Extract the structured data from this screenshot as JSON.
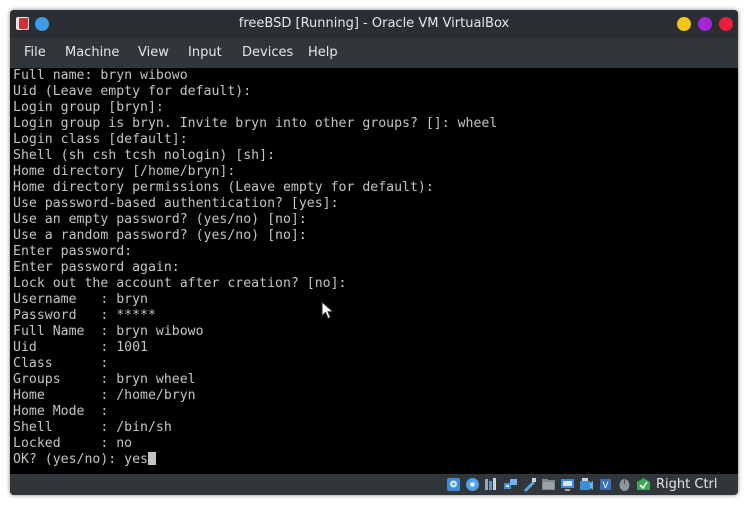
{
  "window": {
    "title": "freeBSD [Running] - Oracle VM VirtualBox"
  },
  "menu": {
    "file": "File",
    "machine": "Machine",
    "view": "View",
    "input": "Input",
    "devices": "Devices",
    "help": "Help"
  },
  "console": {
    "lines": [
      "Full name: bryn wibowo",
      "Uid (Leave empty for default):",
      "Login group [bryn]:",
      "Login group is bryn. Invite bryn into other groups? []: wheel",
      "Login class [default]:",
      "Shell (sh csh tcsh nologin) [sh]:",
      "Home directory [/home/bryn]:",
      "Home directory permissions (Leave empty for default):",
      "Use password-based authentication? [yes]:",
      "Use an empty password? (yes/no) [no]:",
      "Use a random password? (yes/no) [no]:",
      "Enter password:",
      "Enter password again:",
      "Lock out the account after creation? [no]:",
      "Username   : bryn",
      "Password   : *****",
      "Full Name  : bryn wibowo",
      "Uid        : 1001",
      "Class      :",
      "Groups     : bryn wheel",
      "Home       : /home/bryn",
      "Home Mode  :",
      "Shell      : /bin/sh",
      "Locked     : no"
    ],
    "prompt": "OK? (yes/no): yes"
  },
  "statusbar": {
    "host_key": "Right Ctrl",
    "icons": [
      "hard-disk-icon",
      "optical-disk-icon",
      "audio-icon",
      "network-icon",
      "usb-icon",
      "shared-folders-icon",
      "display-icon",
      "recording-icon",
      "cpu-icon",
      "mouse-integration-icon",
      "keyboard-icon"
    ]
  },
  "colors": {
    "titlebar": "#2b2f33",
    "chrome": "#31363b",
    "console_bg": "#000000",
    "console_text": "#c4c4c4",
    "close": "#ed1c3c",
    "maximize": "#a325d9",
    "minimize": "#f5c518",
    "pin": "#3d9de6"
  }
}
